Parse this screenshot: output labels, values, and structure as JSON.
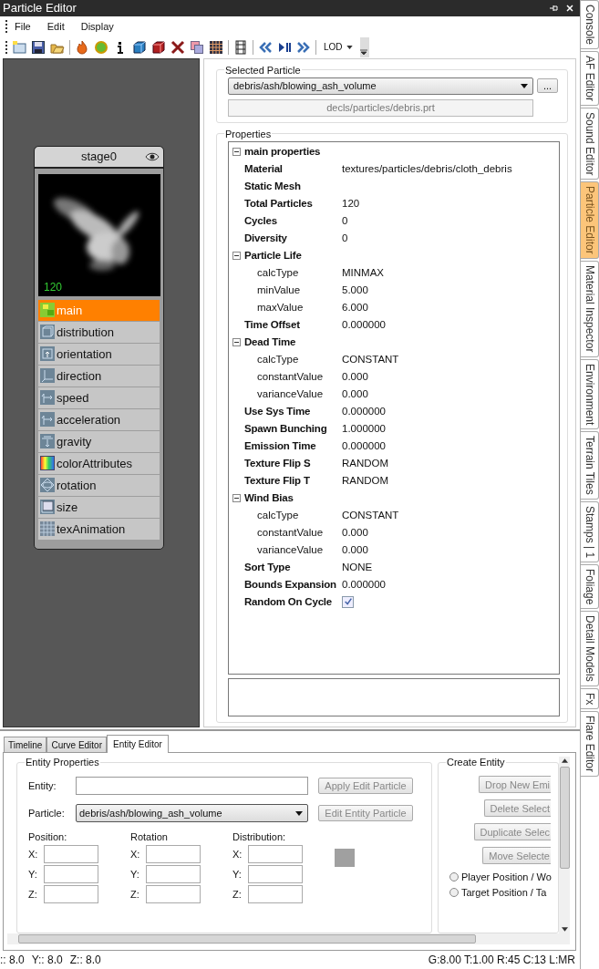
{
  "window": {
    "title": "Particle Editor"
  },
  "menu": [
    "File",
    "Edit",
    "Display"
  ],
  "toolbar": {
    "lod_label": "LOD"
  },
  "stage": {
    "title": "stage0",
    "count": "120",
    "items": [
      {
        "label": "main",
        "selected": true
      },
      {
        "label": "distribution",
        "selected": false
      },
      {
        "label": "orientation",
        "selected": false
      },
      {
        "label": "direction",
        "selected": false
      },
      {
        "label": "speed",
        "selected": false
      },
      {
        "label": "acceleration",
        "selected": false
      },
      {
        "label": "gravity",
        "selected": false
      },
      {
        "label": "colorAttributes",
        "selected": false
      },
      {
        "label": "rotation",
        "selected": false
      },
      {
        "label": "size",
        "selected": false
      },
      {
        "label": "texAnimation",
        "selected": false
      }
    ]
  },
  "selected_particle": {
    "title": "Selected Particle",
    "particle": "debris/ash/blowing_ash_volume",
    "browse_label": "...",
    "file": "decls/particles/debris.prt"
  },
  "properties": {
    "title": "Properties",
    "tree": [
      {
        "label": "main properties",
        "expanded": true,
        "children": [
          {
            "label": "Material",
            "value": "textures/particles/debris/cloth_debris"
          },
          {
            "label": "Static Mesh"
          },
          {
            "label": "Total Particles",
            "value": "120"
          },
          {
            "label": "Cycles",
            "value": "0"
          },
          {
            "label": "Diversity",
            "value": "0"
          },
          {
            "label": "Particle Life",
            "expanded": true,
            "children": [
              {
                "label": "calcType",
                "value": "MINMAX"
              },
              {
                "label": "minValue",
                "value": "5.000"
              },
              {
                "label": "maxValue",
                "value": "6.000"
              }
            ]
          },
          {
            "label": "Time Offset",
            "value": "0.000000"
          },
          {
            "label": "Dead Time",
            "expanded": true,
            "children": [
              {
                "label": "calcType",
                "value": "CONSTANT"
              },
              {
                "label": "constantValue",
                "value": "0.000"
              },
              {
                "label": "varianceValue",
                "value": "0.000"
              }
            ]
          },
          {
            "label": "Use Sys Time",
            "value": "0.000000"
          },
          {
            "label": "Spawn Bunching",
            "value": "1.000000"
          },
          {
            "label": "Emission Time",
            "value": "0.000000"
          },
          {
            "label": "Texture Flip S",
            "value": "RANDOM"
          },
          {
            "label": "Texture Flip T",
            "value": "RANDOM"
          },
          {
            "label": "Wind Bias",
            "expanded": true,
            "children": [
              {
                "label": "calcType",
                "value": "CONSTANT"
              },
              {
                "label": "constantValue",
                "value": "0.000"
              },
              {
                "label": "varianceValue",
                "value": "0.000"
              }
            ]
          },
          {
            "label": "Sort Type",
            "value": "NONE"
          },
          {
            "label": "Bounds Expansion",
            "value": "0.000000"
          },
          {
            "label": "Random On Cycle",
            "kind": "checkbox",
            "checked": true
          }
        ]
      }
    ]
  },
  "bottom_tabs": [
    {
      "label": "Timeline",
      "selected": false
    },
    {
      "label": "Curve Editor",
      "selected": false
    },
    {
      "label": "Entity Editor",
      "selected": true
    }
  ],
  "entity_editor": {
    "title": "Entity Properties",
    "entity_label": "Entity:",
    "apply_button": {
      "label": "Apply Edit Particle",
      "disabled": true
    },
    "particle_label": "Particle:",
    "particle_value": "debris/ash/blowing_ash_volume",
    "edit_button": {
      "label": "Edit Entity Particle",
      "disabled": true
    },
    "groups": [
      {
        "title": "Position:",
        "axes": [
          "X:",
          "Y:",
          "Z:"
        ]
      },
      {
        "title": "Rotation",
        "axes": [
          "X:",
          "Y:",
          "Z:"
        ]
      },
      {
        "title": "Distribution:",
        "axes": [
          "X:",
          "Y:",
          "Z:"
        ]
      }
    ]
  },
  "create_entity": {
    "title": "Create Entity",
    "buttons": [
      {
        "label": "Drop New Emi",
        "disabled": true
      },
      {
        "label": "Delete Select",
        "disabled": true
      },
      {
        "label": "Duplicate Selec",
        "disabled": true
      },
      {
        "label": "Move Selecte",
        "disabled": true
      }
    ],
    "options": [
      {
        "label": "Player Position / Wo",
        "selected": false
      },
      {
        "label": "Target Position / Ta",
        "selected": false
      }
    ]
  },
  "status": {
    "left": [
      ":: 8.0",
      "Y:: 8.0",
      "Z:: 8.0"
    ],
    "right": "G:8.00 T:1.00 R:45 C:13 L:MR"
  },
  "side_tabs": [
    {
      "label": "Console",
      "selected": false
    },
    {
      "label": "AF Editor",
      "selected": false
    },
    {
      "label": "Sound Editor",
      "selected": false
    },
    {
      "label": "Particle Editor",
      "selected": true
    },
    {
      "label": "Material Inspector",
      "selected": false
    },
    {
      "label": "Environment",
      "selected": false
    },
    {
      "label": "Terrain Tiles",
      "selected": false
    },
    {
      "label": "Stamps | 1",
      "selected": false
    },
    {
      "label": "Foliage",
      "selected": false
    },
    {
      "label": "Detail Models",
      "selected": false
    },
    {
      "label": "Fx",
      "selected": false
    },
    {
      "label": "Flare Editor",
      "selected": false
    }
  ]
}
